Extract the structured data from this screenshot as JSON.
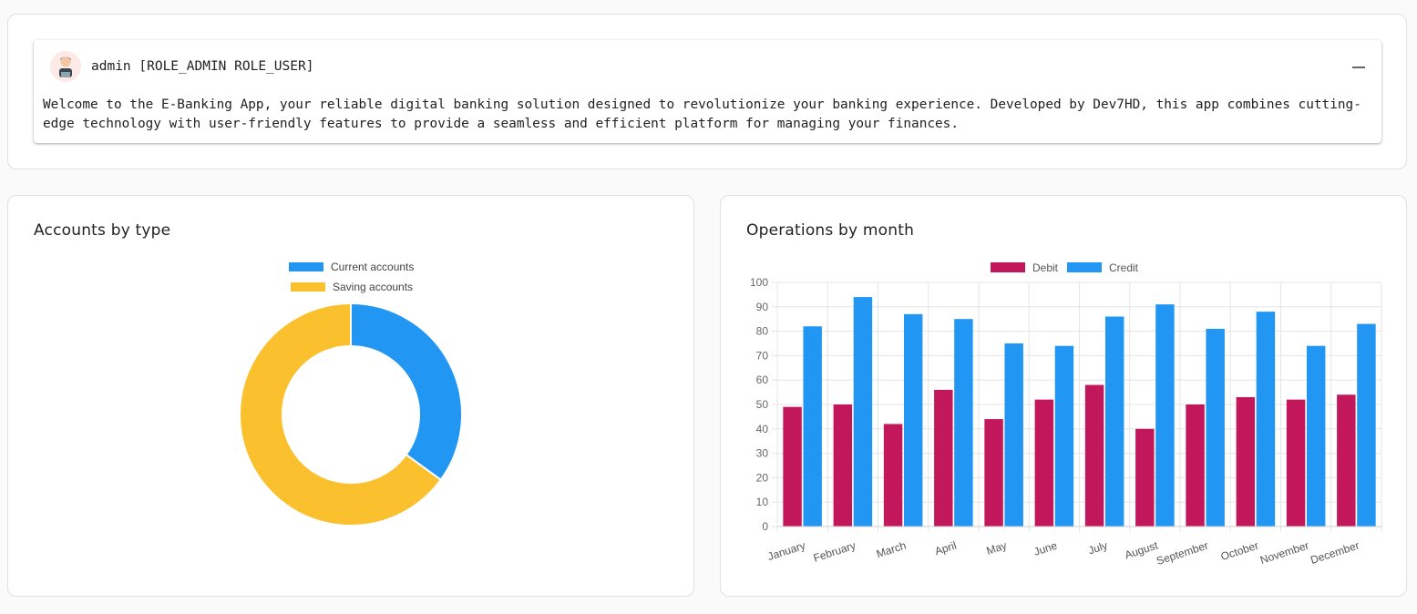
{
  "user": {
    "line": "admin [ROLE_ADMIN ROLE_USER]",
    "welcome": "Welcome to the E-Banking App, your reliable digital banking solution designed to revolutionize your banking experience. Developed by Dev7HD, this app combines cutting-edge technology with user-friendly features to provide a seamless and efficient platform for managing your finances."
  },
  "accounts_card": {
    "title": "Accounts by type"
  },
  "operations_card": {
    "title": "Operations by month"
  },
  "colors": {
    "current": "#2196f3",
    "saving": "#fbc02d",
    "debit": "#c2185b",
    "credit": "#2196f3"
  },
  "chart_data": [
    {
      "type": "pie",
      "labels": [
        "Current accounts",
        "Saving accounts"
      ],
      "values": [
        35,
        65
      ],
      "legend": "top"
    },
    {
      "type": "bar",
      "categories": [
        "January",
        "February",
        "March",
        "April",
        "May",
        "June",
        "July",
        "August",
        "September",
        "October",
        "November",
        "December"
      ],
      "series": [
        {
          "name": "Debit",
          "values": [
            49,
            50,
            42,
            56,
            44,
            52,
            58,
            40,
            50,
            53,
            52,
            54
          ]
        },
        {
          "name": "Credit",
          "values": [
            82,
            94,
            87,
            85,
            75,
            74,
            86,
            91,
            81,
            88,
            74,
            83
          ]
        }
      ],
      "ylim": [
        0,
        100
      ],
      "yticks": [
        0,
        10,
        20,
        30,
        40,
        50,
        60,
        70,
        80,
        90,
        100
      ],
      "grid": true,
      "legend": "top"
    }
  ]
}
